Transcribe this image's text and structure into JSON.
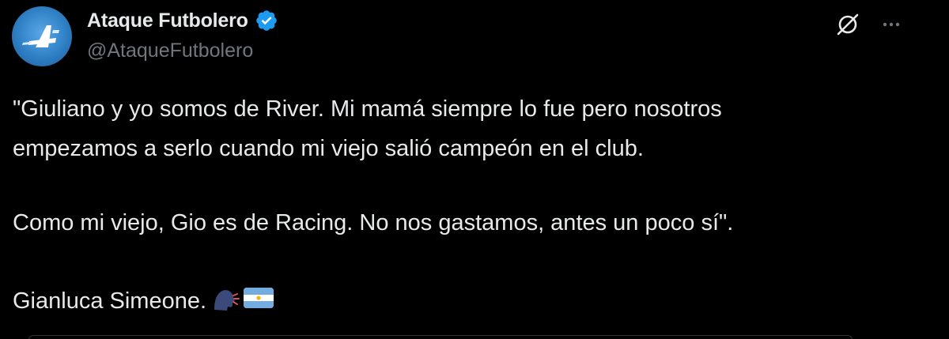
{
  "tweet": {
    "display_name": "Ataque Futbolero",
    "handle": "@AtaqueFutbolero",
    "lines": [
      "\"Giuliano y yo somos de River. Mi mamá siempre lo fue pero nosotros",
      "empezamos a serlo cuando mi viejo salió campeón en el club.",
      "Como mi viejo, Gio es de Racing. No nos gastamos, antes un poco sí\".",
      "Gianluca Simeone."
    ],
    "emojis": [
      "speaking-head",
      "flag-argentina"
    ]
  },
  "icons": {
    "avatar": "ataque-futbolero-logo",
    "verified": "verified-badge-icon",
    "grok": "grok-icon",
    "more": "more-horizontal-icon"
  },
  "colors": {
    "background": "#000000",
    "text": "#e7e9ea",
    "secondary": "#71767b",
    "verified": "#1d9bf0"
  }
}
